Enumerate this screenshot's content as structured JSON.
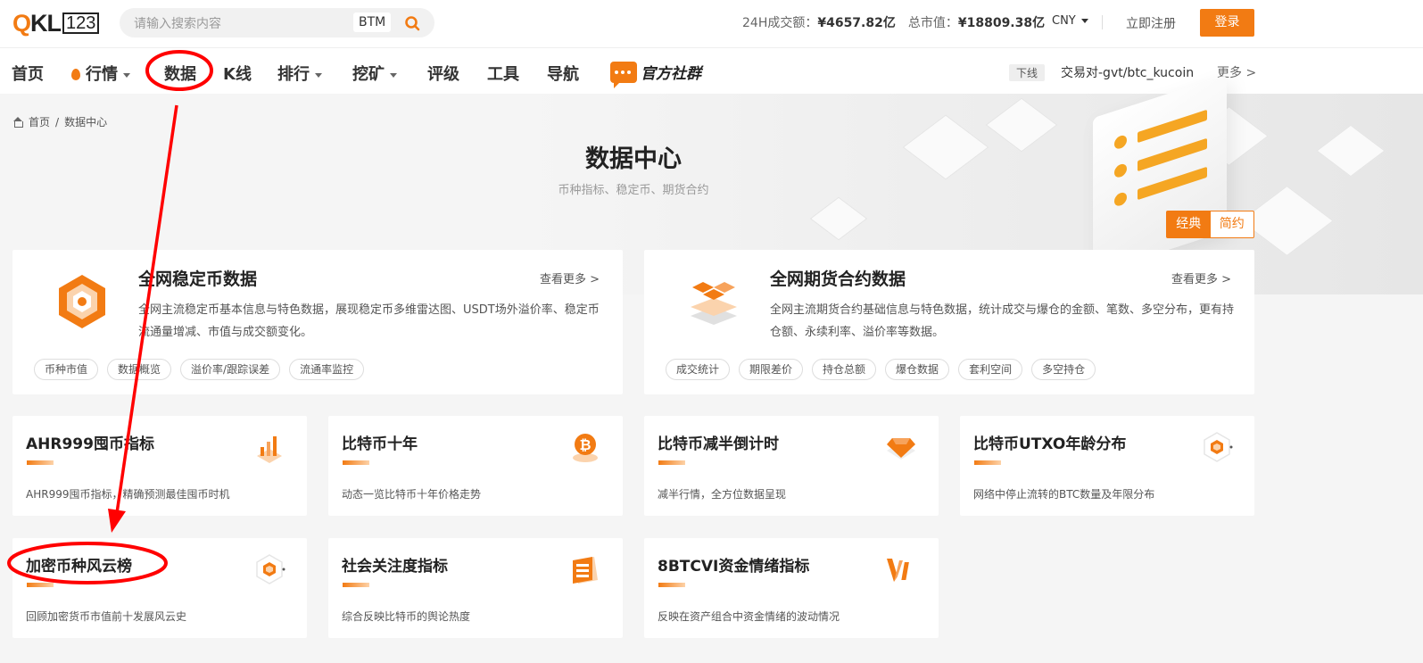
{
  "header": {
    "logo_main": "QKL",
    "logo_num": "123",
    "search_placeholder": "请输入搜索内容",
    "search_hot": "BTM",
    "stats_24h_label": "24H成交额：",
    "stats_24h_value": "¥4657.82亿",
    "stats_cap_label": "总市值：",
    "stats_cap_value": "¥18809.38亿",
    "currency": "CNY",
    "register": "立即注册",
    "login": "登录"
  },
  "nav": {
    "items": [
      "首页",
      "行情",
      "数据",
      "K线",
      "排行",
      "挖矿",
      "评级",
      "工具",
      "导航"
    ],
    "community": "官方社群",
    "ticker_tag": "下线",
    "ticker": "交易对-gvt/btc_kucoin",
    "more": "更多 >"
  },
  "breadcrumb": {
    "home": "首页",
    "sep": "/",
    "current": "数据中心"
  },
  "hero": {
    "title": "数据中心",
    "subtitle": "币种指标、稳定币、期货合约",
    "toggle_on": "经典",
    "toggle_off": "简约"
  },
  "big_cards": [
    {
      "title": "全网稳定币数据",
      "more": "查看更多 >",
      "desc": "全网主流稳定币基本信息与特色数据，展现稳定币多维雷达图、USDT场外溢价率、稳定币流通量增减、市值与成交额变化。",
      "tags": [
        "币种市值",
        "数据概览",
        "溢价率/跟踪误差",
        "流通率监控"
      ]
    },
    {
      "title": "全网期货合约数据",
      "more": "查看更多 >",
      "desc": "全网主流期货合约基础信息与特色数据，统计成交与爆仓的金额、笔数、多空分布，更有持仓额、永续利率、溢价率等数据。",
      "tags": [
        "成交统计",
        "期限差价",
        "持仓总额",
        "爆仓数据",
        "套利空间",
        "多空持仓"
      ]
    }
  ],
  "cards": [
    {
      "title": "AHR999囤币指标",
      "desc": "AHR999囤币指标，精确预测最佳囤币时机",
      "icon": "bar-chart-icon"
    },
    {
      "title": "比特币十年",
      "desc": "动态一览比特币十年价格走势",
      "icon": "bitcoin-icon"
    },
    {
      "title": "比特币减半倒计时",
      "desc": "减半行情，全方位数据呈现",
      "icon": "diamond-icon"
    },
    {
      "title": "比特币UTXO年龄分布",
      "desc": "网络中停止流转的BTC数量及年限分布",
      "icon": "hexagon-icon"
    },
    {
      "title": "加密币种风云榜",
      "desc": "回顾加密货币市值前十发展风云史",
      "icon": "hexagon-icon"
    },
    {
      "title": "社会关注度指标",
      "desc": "综合反映比特币的舆论热度",
      "icon": "stack-icon"
    },
    {
      "title": "8BTCVI资金情绪指标",
      "desc": "反映在资产组合中资金情绪的波动情况",
      "icon": "vi-icon"
    }
  ],
  "colors": {
    "accent": "#f27b13",
    "annotation": "#ff0000"
  }
}
